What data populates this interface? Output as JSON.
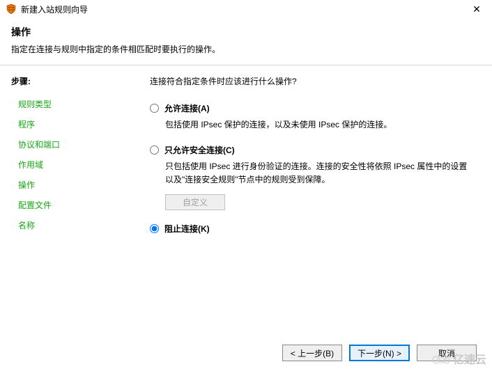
{
  "window": {
    "title": "新建入站规则向导",
    "close_glyph": "✕"
  },
  "header": {
    "title": "操作",
    "subtitle": "指定在连接与规则中指定的条件相匹配时要执行的操作。"
  },
  "sidebar": {
    "steps_label": "步骤:",
    "items": [
      {
        "label": "规则类型"
      },
      {
        "label": "程序"
      },
      {
        "label": "协议和端口"
      },
      {
        "label": "作用域"
      },
      {
        "label": "操作"
      },
      {
        "label": "配置文件"
      },
      {
        "label": "名称"
      }
    ]
  },
  "main": {
    "question": "连接符合指定条件时应该进行什么操作?",
    "options": {
      "allow": {
        "label": "允许连接(A)",
        "desc": "包括使用 IPsec 保护的连接，以及未使用 IPsec 保护的连接。"
      },
      "secure": {
        "label": "只允许安全连接(C)",
        "desc": "只包括使用 IPsec 进行身份验证的连接。连接的安全性将依照 IPsec 属性中的设置以及\"连接安全规则\"节点中的规则受到保障。",
        "custom_btn": "自定义"
      },
      "block": {
        "label": "阻止连接(K)"
      }
    },
    "selected": "block"
  },
  "footer": {
    "back": "< 上一步(B)",
    "next": "下一步(N) >",
    "cancel": "取消"
  },
  "watermark": "亿速云"
}
